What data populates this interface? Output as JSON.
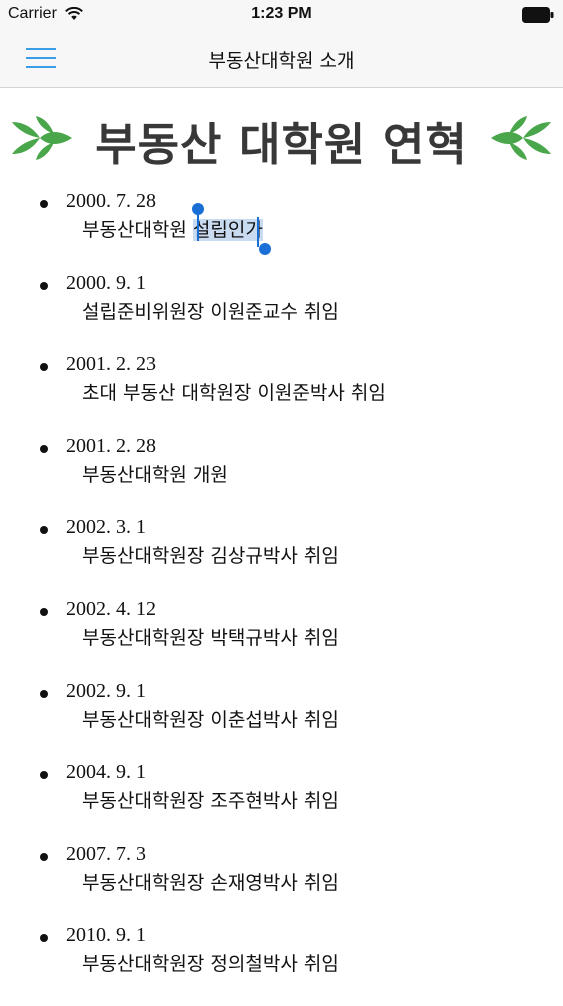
{
  "status_bar": {
    "carrier": "Carrier",
    "time": "1:23 PM",
    "wifi_icon": "wifi-icon",
    "battery_icon": "battery-icon"
  },
  "nav": {
    "title": "부동산대학원 소개",
    "menu_icon": "hamburger-menu-icon",
    "accent_color": "#3a9ee4"
  },
  "page": {
    "heading": "부동산 대학원 연혁",
    "ornament_color": "#4aa64a"
  },
  "history": [
    {
      "date": "2000. 7. 28",
      "desc_pre": "부동산대학원 ",
      "desc_selected": "설립인가"
    },
    {
      "date": "2000. 9. 1",
      "desc": "설립준비위원장 이원준교수 취임"
    },
    {
      "date": "2001. 2. 23",
      "desc": "초대 부동산 대학원장 이원준박사 취임"
    },
    {
      "date": "2001. 2. 28",
      "desc": "부동산대학원 개원"
    },
    {
      "date": "2002. 3. 1",
      "desc": "부동산대학원장 김상규박사 취임"
    },
    {
      "date": "2002. 4. 12",
      "desc": "부동산대학원장 박택규박사 취임"
    },
    {
      "date": "2002. 9. 1",
      "desc": "부동산대학원장 이춘섭박사 취임"
    },
    {
      "date": "2004. 9. 1",
      "desc": "부동산대학원장 조주현박사 취임"
    },
    {
      "date": "2007. 7. 3",
      "desc": "부동산대학원장 손재영박사 취임"
    },
    {
      "date": "2010. 9. 1",
      "desc": "부동산대학원장 정의철박사 취임"
    }
  ],
  "selection_color": "#c9dbf0",
  "selection_handle_color": "#1a6fd6"
}
